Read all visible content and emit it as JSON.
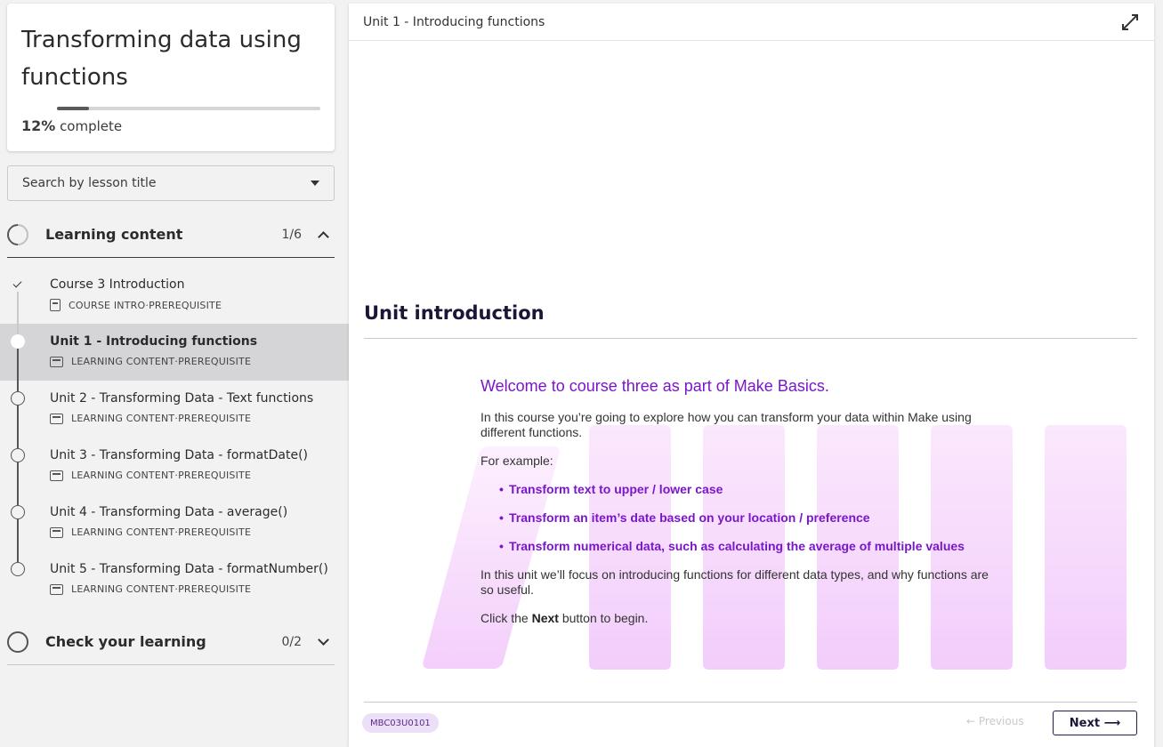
{
  "course": {
    "title": "Transforming data using functions",
    "progress_percent": 12,
    "progress_value": "12%",
    "progress_suffix": " complete"
  },
  "search": {
    "placeholder": "Search by lesson title"
  },
  "sections": [
    {
      "title": "Learning content",
      "count": "1/6",
      "expanded": true
    },
    {
      "title": "Check your learning",
      "count": "0/2",
      "expanded": false
    }
  ],
  "lessons": [
    {
      "title": "Course 3 Introduction",
      "type": "COURSE INTRO",
      "tag": "PREREQUISITE",
      "status": "done",
      "icon": "document-icon"
    },
    {
      "title": "Unit 1 - Introducing functions",
      "type": "LEARNING CONTENT",
      "tag": "PREREQUISITE",
      "status": "active",
      "icon": "slides-icon"
    },
    {
      "title": "Unit 2 - Transforming Data - Text functions",
      "type": "LEARNING CONTENT",
      "tag": "PREREQUISITE",
      "status": "todo",
      "icon": "slides-icon"
    },
    {
      "title": "Unit 3 - Transforming Data - formatDate()",
      "type": "LEARNING CONTENT",
      "tag": "PREREQUISITE",
      "status": "todo",
      "icon": "slides-icon"
    },
    {
      "title": "Unit 4 - Transforming Data - average()",
      "type": "LEARNING CONTENT",
      "tag": "PREREQUISITE",
      "status": "todo",
      "icon": "slides-icon"
    },
    {
      "title": "Unit 5 - Transforming Data - formatNumber()",
      "type": "LEARNING CONTENT",
      "tag": "PREREQUISITE",
      "status": "todo",
      "icon": "slides-icon"
    }
  ],
  "meta_separator": " · ",
  "main": {
    "header_title": "Unit 1 - Introducing functions",
    "heading": "Unit introduction",
    "welcome": "Welcome to course three as part of Make Basics.",
    "intro": "In this course you’re going to explore how you can transform your data within Make using different functions.",
    "example_label": "For example:",
    "bullets": [
      "Transform text to upper / lower case",
      "Transform an item’s date based on your location / preference",
      "Transform numerical data, such as calculating the average of multiple values"
    ],
    "focus": "In this unit we’ll focus on introducing functions for different data types, and why functions are so useful.",
    "cta_before": "Click the ",
    "cta_bold": "Next",
    "cta_after": " button to begin.",
    "code": "MBC03U0101",
    "previous_label": "← Previous",
    "next_label": "Next ⟶"
  },
  "colors": {
    "accent": "#7a16c9",
    "heading": "#1e1438",
    "active_row": "#d5d5d8"
  }
}
